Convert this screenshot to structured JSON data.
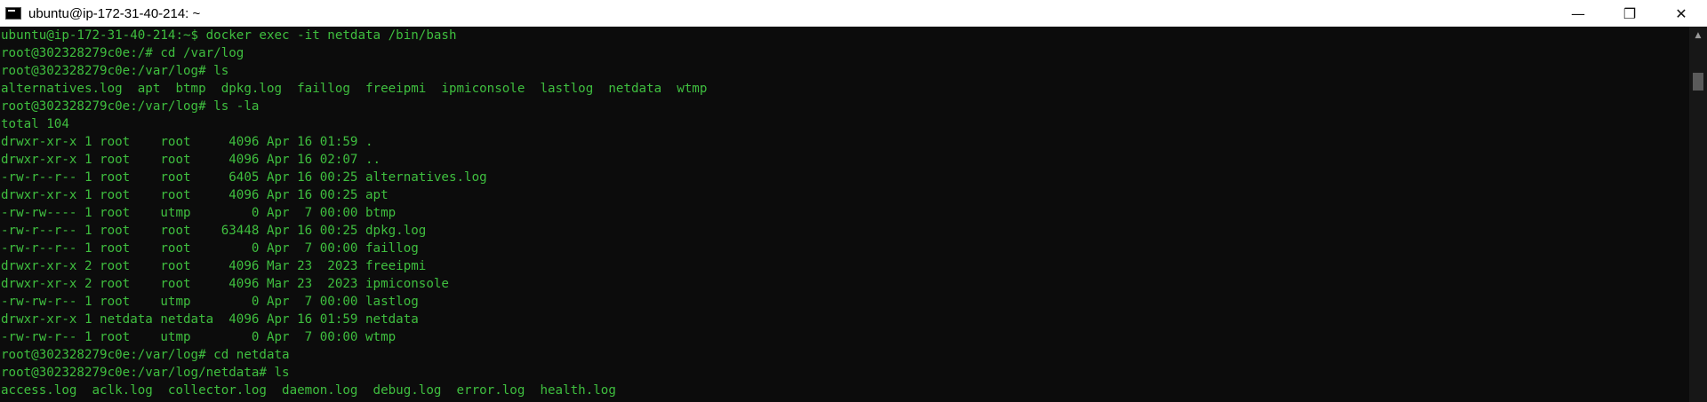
{
  "window": {
    "title": "ubuntu@ip-172-31-40-214: ~",
    "icon": "console-icon",
    "controls": {
      "minimize": "—",
      "maximize": "❐",
      "close": "✕"
    }
  },
  "colors": {
    "terminal_text": "#3fbf3f",
    "terminal_bg": "#0c0c0c",
    "titlebar_bg": "#ffffff"
  },
  "terminal": {
    "lines": [
      "ubuntu@ip-172-31-40-214:~$ docker exec -it netdata /bin/bash",
      "root@302328279c0e:/# cd /var/log",
      "root@302328279c0e:/var/log# ls",
      "alternatives.log  apt  btmp  dpkg.log  faillog  freeipmi  ipmiconsole  lastlog  netdata  wtmp",
      "root@302328279c0e:/var/log# ls -la",
      "total 104",
      "drwxr-xr-x 1 root    root     4096 Apr 16 01:59 .",
      "drwxr-xr-x 1 root    root     4096 Apr 16 02:07 ..",
      "-rw-r--r-- 1 root    root     6405 Apr 16 00:25 alternatives.log",
      "drwxr-xr-x 1 root    root     4096 Apr 16 00:25 apt",
      "-rw-rw---- 1 root    utmp        0 Apr  7 00:00 btmp",
      "-rw-r--r-- 1 root    root    63448 Apr 16 00:25 dpkg.log",
      "-rw-r--r-- 1 root    root        0 Apr  7 00:00 faillog",
      "drwxr-xr-x 2 root    root     4096 Mar 23  2023 freeipmi",
      "drwxr-xr-x 2 root    root     4096 Mar 23  2023 ipmiconsole",
      "-rw-rw-r-- 1 root    utmp        0 Apr  7 00:00 lastlog",
      "drwxr-xr-x 1 netdata netdata  4096 Apr 16 01:59 netdata",
      "-rw-rw-r-- 1 root    utmp        0 Apr  7 00:00 wtmp",
      "root@302328279c0e:/var/log# cd netdata",
      "root@302328279c0e:/var/log/netdata# ls",
      "access.log  aclk.log  collector.log  daemon.log  debug.log  error.log  health.log"
    ]
  }
}
